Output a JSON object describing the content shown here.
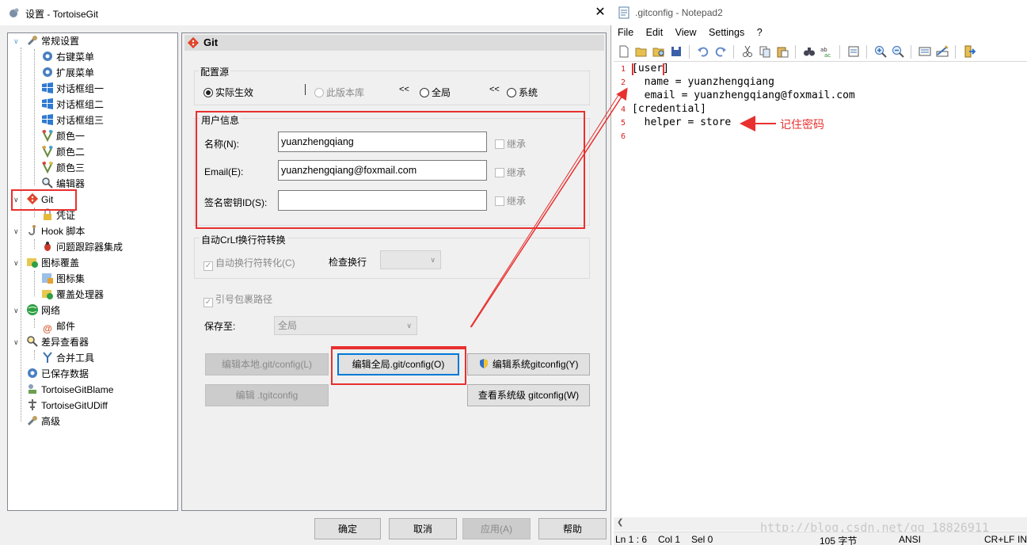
{
  "dialog": {
    "title": "设置 - TortoiseGit",
    "close_glyph": "✕",
    "tree": [
      {
        "label": "常规设置"
      },
      {
        "label": "右键菜单"
      },
      {
        "label": "扩展菜单"
      },
      {
        "label": "对话框组一"
      },
      {
        "label": "对话框组二"
      },
      {
        "label": "对话框组三"
      },
      {
        "label": "颜色一"
      },
      {
        "label": "颜色二"
      },
      {
        "label": "颜色三"
      },
      {
        "label": "编辑器"
      },
      {
        "label": "Git"
      },
      {
        "label": "凭证"
      },
      {
        "label": "Hook 脚本"
      },
      {
        "label": "问题跟踪器集成"
      },
      {
        "label": "图标覆盖"
      },
      {
        "label": "图标集"
      },
      {
        "label": "覆盖处理器"
      },
      {
        "label": "网络"
      },
      {
        "label": "邮件"
      },
      {
        "label": "差异查看器"
      },
      {
        "label": "合并工具"
      },
      {
        "label": "已保存数据"
      },
      {
        "label": "TortoiseGitBlame"
      },
      {
        "label": "TortoiseGitUDiff"
      },
      {
        "label": "高级"
      }
    ],
    "page_title": "Git",
    "config_source": {
      "group_label": "配置源",
      "options": [
        "实际生效",
        "此版本库",
        "全局",
        "系统"
      ],
      "arrows": [
        "<<",
        "<<"
      ],
      "selected": "实际生效"
    },
    "user_info": {
      "group_label": "用户信息",
      "name_label": "名称(N):",
      "name_value": "yuanzhengqiang",
      "email_label": "Email(E):",
      "email_value": "yuanzhengqiang@foxmail.com",
      "signing_label": "签名密钥ID(S):",
      "signing_value": "",
      "inherit_label": "继承"
    },
    "crlf": {
      "group_label": "自动CrLf换行符转换",
      "autocrlf_label": "自动换行符转化(C)",
      "check_label": "检查换行",
      "check_value": ""
    },
    "quote_path_label": "引号包裹路径",
    "save_to_label": "保存至:",
    "save_to_value": "全局",
    "buttons": {
      "edit_local": "编辑本地.git/config(L)",
      "edit_global": "编辑全局.git/config(O)",
      "edit_system": "编辑系统gitconfig(Y)",
      "edit_tgit": "编辑 .tgitconfig",
      "view_system": "查看系统级 gitconfig(W)",
      "ok": "确定",
      "cancel": "取消",
      "apply": "应用(A)",
      "help": "帮助"
    }
  },
  "notepad": {
    "title": ".gitconfig - Notepad2",
    "menu": [
      "File",
      "Edit",
      "View",
      "Settings",
      "?"
    ],
    "lines": [
      {
        "num": "1",
        "text": "[user]"
      },
      {
        "num": "2",
        "text": "  name = yuanzhengqiang"
      },
      {
        "num": "3",
        "text": "  email = yuanzhengqiang@foxmail.com"
      },
      {
        "num": "4",
        "text": "[credential]"
      },
      {
        "num": "5",
        "text": "  helper = store"
      },
      {
        "num": "6",
        "text": ""
      }
    ],
    "annotation": "记住密码",
    "status": {
      "position": "Ln 1 : 6",
      "col": "Col 1",
      "sel": "Sel 0",
      "size": "105 字节",
      "encoding": "ANSI",
      "eol": "CR+LF",
      "mode": "IN"
    },
    "watermark": "http://blog.csdn.net/qq_18826911"
  },
  "colors": {
    "highlight_red": "#e8302f",
    "focus_blue": "#0078d7",
    "line_number_red": "#d62020"
  }
}
